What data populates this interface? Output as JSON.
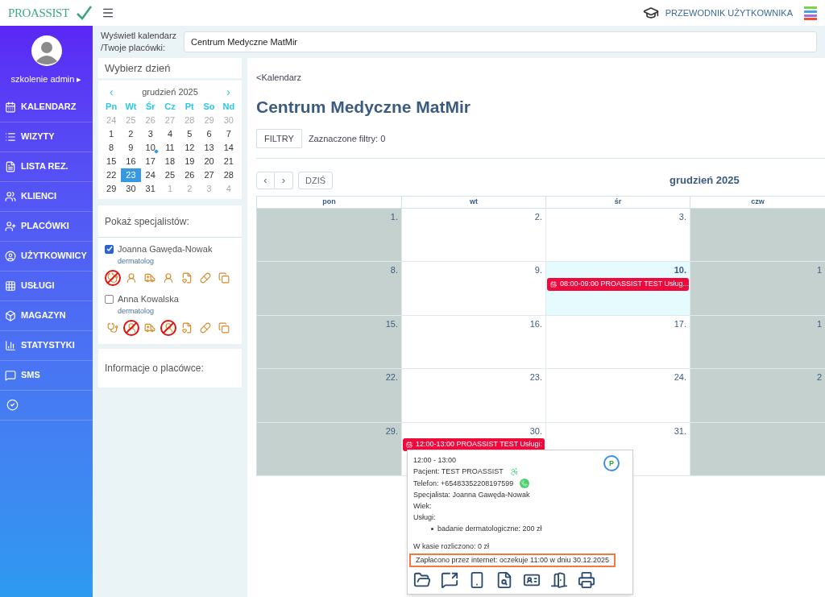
{
  "header": {
    "logo": "PROASSIST",
    "guide": "PRZEWODNIK UŻYTKOWNIKA"
  },
  "sidebar": {
    "user": "szkolenie admin",
    "user_arrow": "▸",
    "items": [
      {
        "label": "KALENDARZ"
      },
      {
        "label": "WIZYTY"
      },
      {
        "label": "LISTA REZ."
      },
      {
        "label": "KLIENCI"
      },
      {
        "label": "PLACÓWKI"
      },
      {
        "label": "UŻYTKOWNICY"
      },
      {
        "label": "USŁUGI"
      },
      {
        "label": "MAGAZYN"
      },
      {
        "label": "STATYSTYKI"
      },
      {
        "label": "SMS"
      }
    ]
  },
  "location": {
    "label": "Wyświetl kalendarz /Twoje placówki:",
    "value": "Centrum Medyczne MatMir"
  },
  "day_picker": {
    "title": "Wybierz dzień",
    "prev": "‹",
    "next": "›",
    "month": "grudzień 2025",
    "weekdays": [
      "Pn",
      "Wt",
      "Śr",
      "Cz",
      "Pt",
      "So",
      "Nd"
    ],
    "days": [
      {
        "d": "24",
        "muted": true,
        "selected": false,
        "marked": false
      },
      {
        "d": "25",
        "muted": true,
        "selected": false,
        "marked": false
      },
      {
        "d": "26",
        "muted": true,
        "selected": false,
        "marked": false
      },
      {
        "d": "27",
        "muted": true,
        "selected": false,
        "marked": false
      },
      {
        "d": "28",
        "muted": true,
        "selected": false,
        "marked": false
      },
      {
        "d": "29",
        "muted": true,
        "selected": false,
        "marked": false
      },
      {
        "d": "30",
        "muted": true,
        "selected": false,
        "marked": false
      },
      {
        "d": "1",
        "muted": false,
        "selected": false,
        "marked": false
      },
      {
        "d": "2",
        "muted": false,
        "selected": false,
        "marked": false
      },
      {
        "d": "3",
        "muted": false,
        "selected": false,
        "marked": false
      },
      {
        "d": "4",
        "muted": false,
        "selected": false,
        "marked": false
      },
      {
        "d": "5",
        "muted": false,
        "selected": false,
        "marked": false
      },
      {
        "d": "6",
        "muted": false,
        "selected": false,
        "marked": false
      },
      {
        "d": "7",
        "muted": false,
        "selected": false,
        "marked": false
      },
      {
        "d": "8",
        "muted": false,
        "selected": false,
        "marked": false
      },
      {
        "d": "9",
        "muted": false,
        "selected": false,
        "marked": false
      },
      {
        "d": "10",
        "muted": false,
        "selected": false,
        "marked": true
      },
      {
        "d": "11",
        "muted": false,
        "selected": false,
        "marked": false
      },
      {
        "d": "12",
        "muted": false,
        "selected": false,
        "marked": false
      },
      {
        "d": "13",
        "muted": false,
        "selected": false,
        "marked": false
      },
      {
        "d": "14",
        "muted": false,
        "selected": false,
        "marked": false
      },
      {
        "d": "15",
        "muted": false,
        "selected": false,
        "marked": false
      },
      {
        "d": "16",
        "muted": false,
        "selected": false,
        "marked": false
      },
      {
        "d": "17",
        "muted": false,
        "selected": false,
        "marked": false
      },
      {
        "d": "18",
        "muted": false,
        "selected": false,
        "marked": false
      },
      {
        "d": "19",
        "muted": false,
        "selected": false,
        "marked": false
      },
      {
        "d": "20",
        "muted": false,
        "selected": false,
        "marked": false
      },
      {
        "d": "21",
        "muted": false,
        "selected": false,
        "marked": false
      },
      {
        "d": "22",
        "muted": false,
        "selected": false,
        "marked": false
      },
      {
        "d": "23",
        "muted": false,
        "selected": true,
        "marked": false
      },
      {
        "d": "24",
        "muted": false,
        "selected": false,
        "marked": false
      },
      {
        "d": "25",
        "muted": false,
        "selected": false,
        "marked": false
      },
      {
        "d": "26",
        "muted": false,
        "selected": false,
        "marked": false
      },
      {
        "d": "27",
        "muted": false,
        "selected": false,
        "marked": false
      },
      {
        "d": "28",
        "muted": false,
        "selected": false,
        "marked": false
      },
      {
        "d": "29",
        "muted": false,
        "selected": false,
        "marked": false
      },
      {
        "d": "30",
        "muted": false,
        "selected": false,
        "marked": false
      },
      {
        "d": "31",
        "muted": false,
        "selected": false,
        "marked": false
      },
      {
        "d": "1",
        "muted": true,
        "selected": false,
        "marked": false
      },
      {
        "d": "2",
        "muted": true,
        "selected": false,
        "marked": false
      },
      {
        "d": "3",
        "muted": true,
        "selected": false,
        "marked": false
      },
      {
        "d": "4",
        "muted": true,
        "selected": false,
        "marked": false
      }
    ]
  },
  "specialists": {
    "title": "Pokaż specjalistów:",
    "items": [
      {
        "name": "Joanna Gawęda-Nowak",
        "role": "dermatolog",
        "checked": true,
        "icons": [
          {
            "crossed": true
          },
          {
            "crossed": false
          },
          {
            "crossed": false
          },
          {
            "crossed": false
          },
          {
            "crossed": false
          },
          {
            "crossed": false
          },
          {
            "crossed": false
          }
        ]
      },
      {
        "name": "Anna Kowalska",
        "role": "dermatolog",
        "checked": false,
        "icons": [
          {
            "crossed": false
          },
          {
            "crossed": true
          },
          {
            "crossed": false
          },
          {
            "crossed": true
          },
          {
            "crossed": false
          },
          {
            "crossed": false
          },
          {
            "crossed": false
          }
        ]
      }
    ]
  },
  "info": {
    "title": "Informacje o placówce:"
  },
  "main": {
    "back": "<Kalendarz",
    "title": "Centrum Medyczne MatMir",
    "filter_button": "FILTRY",
    "filters": "Zaznaczone filtry: 0",
    "prev": "‹",
    "next": "›",
    "today": "DZIŚ",
    "month": "grudzień 2025",
    "columns": [
      "pon",
      "wt",
      "śr",
      "czw"
    ],
    "weeks": [
      [
        {
          "day": "1.",
          "shaded": true,
          "highlighted": false
        },
        {
          "day": "2.",
          "shaded": false,
          "highlighted": false
        },
        {
          "day": "3.",
          "shaded": false,
          "highlighted": false
        },
        {
          "shaded": true,
          "highlighted": false
        }
      ],
      [
        {
          "day": "8.",
          "shaded": true,
          "highlighted": false
        },
        {
          "day": "9.",
          "shaded": false,
          "highlighted": false
        },
        {
          "day": "10.",
          "shaded": false,
          "highlighted": true,
          "events": [
            {
              "text": "08:00-09:00 PROASSIST TEST Usług..."
            }
          ]
        },
        {
          "day": "1",
          "shaded": true,
          "highlighted": false
        }
      ],
      [
        {
          "day": "15.",
          "shaded": true,
          "highlighted": false
        },
        {
          "day": "16.",
          "shaded": false,
          "highlighted": false
        },
        {
          "day": "17.",
          "shaded": false,
          "highlighted": false
        },
        {
          "day": "1",
          "shaded": true,
          "highlighted": false
        }
      ],
      [
        {
          "day": "22.",
          "shaded": true,
          "highlighted": false
        },
        {
          "day": "23.",
          "shaded": false,
          "highlighted": false
        },
        {
          "day": "24.",
          "shaded": false,
          "highlighted": false
        },
        {
          "day": "2",
          "shaded": true,
          "highlighted": false
        }
      ],
      [
        {
          "day": "29.",
          "shaded": true,
          "highlighted": false
        },
        {
          "day": "30.",
          "shaded": false,
          "highlighted": false,
          "events": [
            {
              "text": "12:00-13:00 PROASSIST TEST Usługi:"
            }
          ]
        },
        {
          "day": "31.",
          "shaded": false,
          "highlighted": false
        },
        {
          "shaded": true,
          "highlighted": false
        }
      ]
    ]
  },
  "popover": {
    "time": "12:00 - 13:00",
    "badge": "P",
    "patient": "Pacjent: TEST PROASSIST",
    "phone": "Telefon: +65483352208197599",
    "specialist": "Specjalista: Joanna Gawęda-Nowak",
    "age": "Wiek:",
    "services_label": "Usługi:",
    "services": [
      "badanie dermatologiczne: 200 zł"
    ],
    "cash": "W kasie rozliczono: 0 zł",
    "paid": "Zapłacono przez internet: oczekuje 11:00 w dniu 30.12.2025"
  }
}
